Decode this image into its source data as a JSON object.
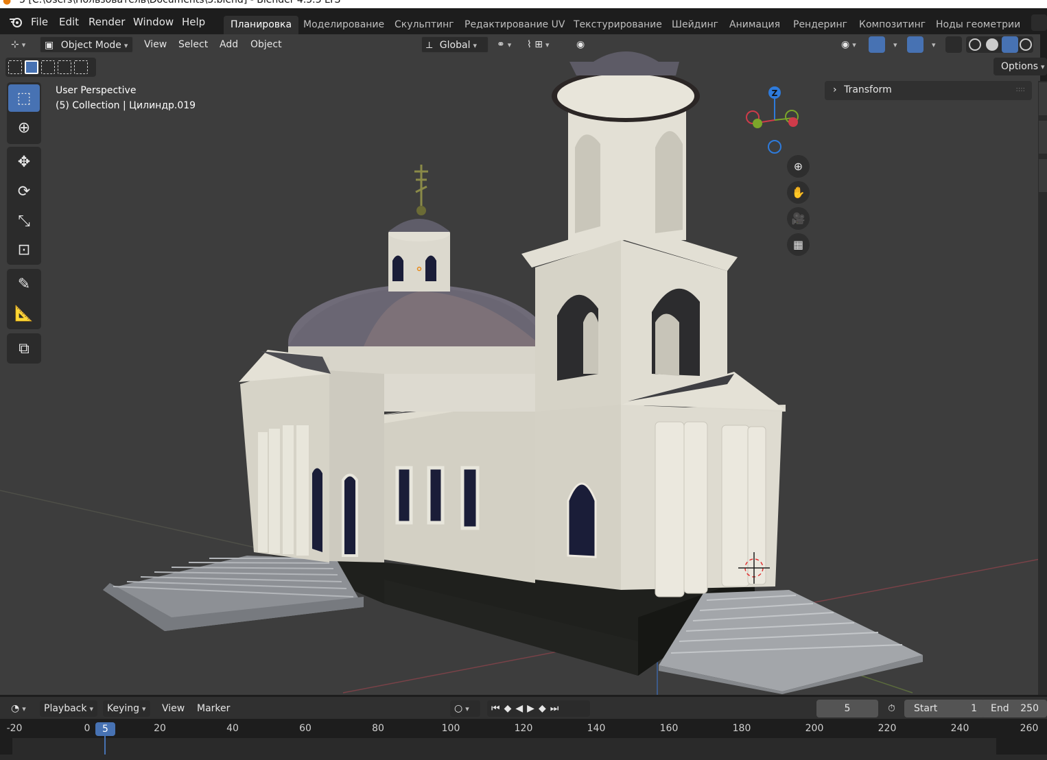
{
  "window": {
    "title": "3 [C:\\Users\\Пользователь\\Documents\\3.blend] - Blender 4.5.3 LTS"
  },
  "menubar": {
    "items": [
      "File",
      "Edit",
      "Render",
      "Window",
      "Help"
    ],
    "workspaces": [
      "Планировка",
      "Моделирование",
      "Скульптинг",
      "Редактирование UV",
      "Текстурирование",
      "Шейдинг",
      "Анимация",
      "Рендеринг",
      "Композитинг",
      "Ноды геометрии"
    ],
    "active_workspace": "Планировка"
  },
  "viewport_header": {
    "mode": "Object Mode",
    "menus": [
      "View",
      "Select",
      "Add",
      "Object"
    ],
    "transform_orientation": "Global"
  },
  "viewport": {
    "perspective_label": "User Perspective",
    "collection_label": "(5) Collection | Цилиндр.019",
    "options_label": "Options",
    "transform_panel_label": "Transform",
    "gizmo_axis_label": "Z",
    "colors": {
      "background": "#3d3d3d",
      "walls": "#d6d3c7",
      "roof": "#5e5d68",
      "dome": "#6f6b78",
      "stairs": "#a4a7ab",
      "plinth": "#1f201d",
      "windows": "#1a1d38",
      "accent": "#4772b3"
    }
  },
  "tools": [
    "select-box",
    "cursor",
    "move",
    "rotate",
    "scale",
    "transform",
    "annotate",
    "measure",
    "add-cube"
  ],
  "timeline": {
    "menus": [
      "Playback",
      "Keying",
      "View",
      "Marker"
    ],
    "current_frame": "5",
    "start_label": "Start",
    "start_value": "1",
    "end_label": "End",
    "end_value": "250",
    "ruler_ticks": [
      "-20",
      "0",
      "20",
      "40",
      "60",
      "80",
      "100",
      "120",
      "140",
      "160",
      "180",
      "200",
      "220",
      "240",
      "260"
    ],
    "cursor_frame": "5"
  }
}
